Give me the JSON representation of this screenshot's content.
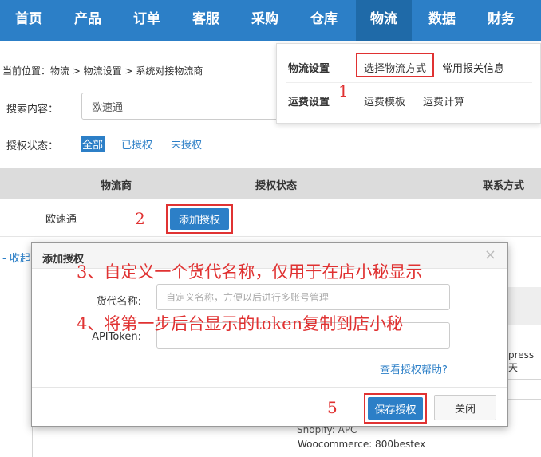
{
  "nav": {
    "items": [
      "首页",
      "产品",
      "订单",
      "客服",
      "采购",
      "仓库",
      "物流",
      "数据",
      "财务"
    ],
    "active_index": 6
  },
  "breadcrumb": "当前位置：物流 > 物流设置 > 系统对接物流商",
  "search": {
    "label": "搜索内容：",
    "value": "欧速通"
  },
  "auth_filter": {
    "label": "授权状态：",
    "options": [
      "全部",
      "已授权",
      "未授权"
    ],
    "active": "全部"
  },
  "table": {
    "headers": [
      "物流商",
      "授权状态",
      "联系方式"
    ],
    "rows": [
      {
        "provider": "欧速通",
        "action": "添加授权"
      }
    ],
    "collapse": "- 收起"
  },
  "dropdown": {
    "logistics_settings": "物流设置",
    "choose_method": "选择物流方式",
    "customs_info": "常用报关信息",
    "freight_settings": "运费设置",
    "freight_template": "运费模板",
    "freight_calc": "运费计算"
  },
  "modal": {
    "title": "添加授权",
    "close_symbol": "×",
    "name_label": "货代名称:",
    "name_placeholder": "自定义名称，方便以后进行多账号管理",
    "token_label": "APIToken:",
    "help": "查看授权帮助?",
    "save": "保存授权",
    "close": "关闭"
  },
  "background_text": {
    "express": "press 天",
    "shopify": "Shopify:   APC",
    "woocommerce": "Woocommerce:  800bestex"
  },
  "annotations": {
    "n1": "1",
    "n2": "2",
    "n5": "5",
    "step3": "3、自定义一个货代名称，仅用于在店小秘显示",
    "step4": "4、将第一步后台显示的token复制到店小秘"
  },
  "colors": {
    "primary": "#2c7fc7",
    "annotation": "#e03232"
  }
}
